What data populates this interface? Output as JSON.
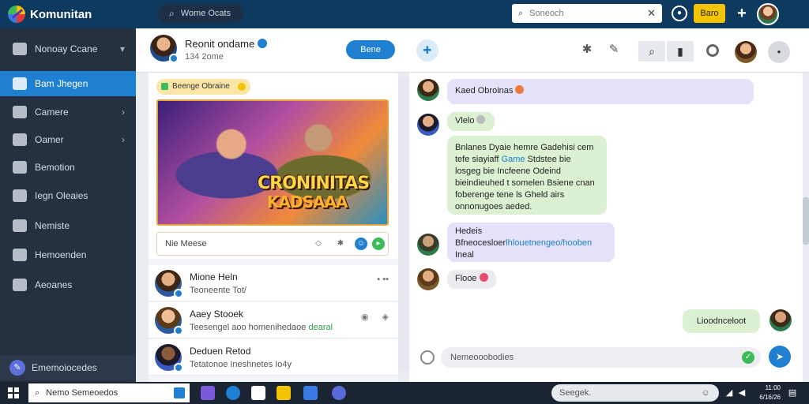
{
  "app": {
    "title": "Komunitan"
  },
  "topbar": {
    "pill_label": "Wome Ocats",
    "search_placeholder": "Soneoch",
    "yellow_button": "Baro"
  },
  "sidebar": {
    "items": [
      {
        "label": "Nonoay Ccane",
        "chevron": true
      },
      {
        "label": "Bam Jhegen",
        "active": true
      },
      {
        "label": "Camere",
        "chevron": true
      },
      {
        "label": "Oamer",
        "chevron": true
      },
      {
        "label": "Bemotion"
      },
      {
        "label": "Iegn Oleaies"
      },
      {
        "label": "Nemiste"
      },
      {
        "label": "Hemoenden"
      },
      {
        "label": "Aeoanes"
      }
    ],
    "bottom_label": "Ememoiocedes"
  },
  "header": {
    "title": "Reonit ondame",
    "subtitle": "134 2ome",
    "button_label": "Bene"
  },
  "post": {
    "tag": "Beenge Obraine",
    "game_title": "CRONINITAS",
    "game_subtitle": "KADSAAA",
    "comment_placeholder": "Nie Meese"
  },
  "feed": [
    {
      "name": "Mione Heln",
      "desc": "Teoneente Tot/",
      "meta": "▪ ▪▪"
    },
    {
      "name": "Aaey Stooek",
      "desc": "Teesengel aoo homenihedaoe",
      "highlight": "dearal",
      "meta": ""
    },
    {
      "name": "Deduen Retod",
      "desc": "Tetatonoe Ineshnetes Io4y",
      "meta": ""
    }
  ],
  "chat": {
    "messages": [
      {
        "text": "Kaed Obroinas",
        "style": "lilac"
      },
      {
        "text": "Vlelo",
        "style": "green"
      },
      {
        "text": "Bnlanes Dyaie hemre Gadehisi cem tefe siayiaff",
        "link": "Game",
        "text2": "Stdstee bie losgeg bie Incfeene Odeind bieindieuhed t somelen Bsiene cnan foberenge tene ls Gheld airs onnonugoes aeded.",
        "style": "green"
      },
      {
        "text": "Hedeis",
        "style": "lilac"
      },
      {
        "text": "Bfneocesloer",
        "link": "lhlouetnengeo/hooben",
        "text2": "Ineal",
        "style": "lilac"
      },
      {
        "text": "Flooe",
        "style": "grey"
      },
      {
        "text": "Lioodnceloot",
        "style": "green"
      }
    ],
    "input_placeholder": "Nemeooobodies"
  },
  "taskbar": {
    "search_text": "Nemo Semeoedos",
    "tray_search": "Seegek.",
    "time": "11:00",
    "date": "6/16/26"
  },
  "colors": {
    "topbar": "#0f3a5f",
    "sidebar": "#253040",
    "accent": "#1f7fd1",
    "highlight_yellow": "#f5c400"
  }
}
